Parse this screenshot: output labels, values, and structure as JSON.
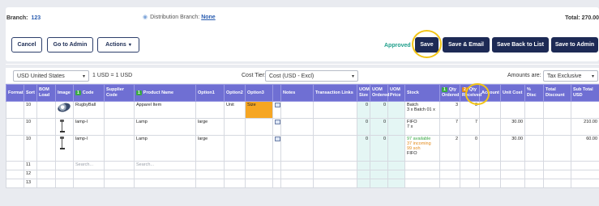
{
  "header": {
    "branch_label": "Branch:",
    "branch_value": "123",
    "dist_label": "Distribution Branch:",
    "dist_value": "None",
    "total_label": "Total: 270.00"
  },
  "toolbar": {
    "cancel": "Cancel",
    "go_to_admin": "Go to Admin",
    "actions": "Actions",
    "status": "Approved",
    "save": "Save",
    "save_email": "Save & Email",
    "save_back": "Save Back to List",
    "save_admin": "Save to Admin"
  },
  "controls": {
    "currency": "USD United States",
    "rate": "1 USD = 1 USD",
    "cost_tier_label": "Cost Tier:",
    "cost_tier_value": "Cost (USD - Excl)",
    "amounts_label": "Amounts are:",
    "amounts_value": "Tax Exclusive"
  },
  "table": {
    "headers": {
      "format": "Format",
      "sort": "Sort",
      "bom": "BOM Load",
      "image": "Image",
      "code_badge": "1",
      "code": "Code",
      "supplier": "Supplier Code",
      "prod_badge": "1",
      "product": "Product Name",
      "option1": "Option1",
      "option2": "Option2",
      "option3": "Option3",
      "notes": "Notes",
      "tlinks": "Transaction Links",
      "uom_size": "UOM Size",
      "uom_ordered": "UOM Ordered",
      "uom_price": "UOM Price",
      "stock": "Stock",
      "qo_badge": "1",
      "qty_ordered": "Qty Ordered",
      "qr_badge": "2",
      "qty_received": "Qty Received",
      "account": "Account",
      "unit_cost": "Unit Cost",
      "disc": "% Disc",
      "total_discount": "Total Discount",
      "subtotal": "Sub Total USD"
    },
    "rows": [
      {
        "sort": "10",
        "code": "RugbyBall",
        "product": "Apparel Item",
        "option1": "",
        "option2": "Unit",
        "option3": "Size",
        "uom_size": "0",
        "uom_ordered": "0",
        "stock1": "Batch",
        "stock2": "3 x Batch 01 x",
        "qty_ordered": "3",
        "qty_received": "3",
        "unit_cost": "",
        "subtotal": ""
      },
      {
        "sort": "10",
        "code": "lamp-l",
        "product": "Lamp",
        "option1": "large",
        "option2": "",
        "option3": "",
        "uom_size": "0",
        "uom_ordered": "0",
        "stock1": "FIFO",
        "stock2": "7 x",
        "qty_ordered": "7",
        "qty_received": "7",
        "unit_cost": "30.00",
        "subtotal": "210.00"
      },
      {
        "sort": "10",
        "code": "lamp-l",
        "product": "Lamp",
        "option1": "large",
        "option2": "",
        "option3": "",
        "uom_size": "0",
        "uom_ordered": "0",
        "stock_avail": "97 available",
        "stock_inc": "37 incoming",
        "stock_soh": "99 soh",
        "stock_method": "FIFO",
        "qty_ordered": "2",
        "qty_received": "0",
        "unit_cost": "30.00",
        "subtotal": "60.00"
      }
    ],
    "empty_rows": [
      {
        "sort": "11",
        "code_ph": "Search...",
        "product_ph": "Search..."
      },
      {
        "sort": "12"
      },
      {
        "sort": "13"
      }
    ]
  }
}
